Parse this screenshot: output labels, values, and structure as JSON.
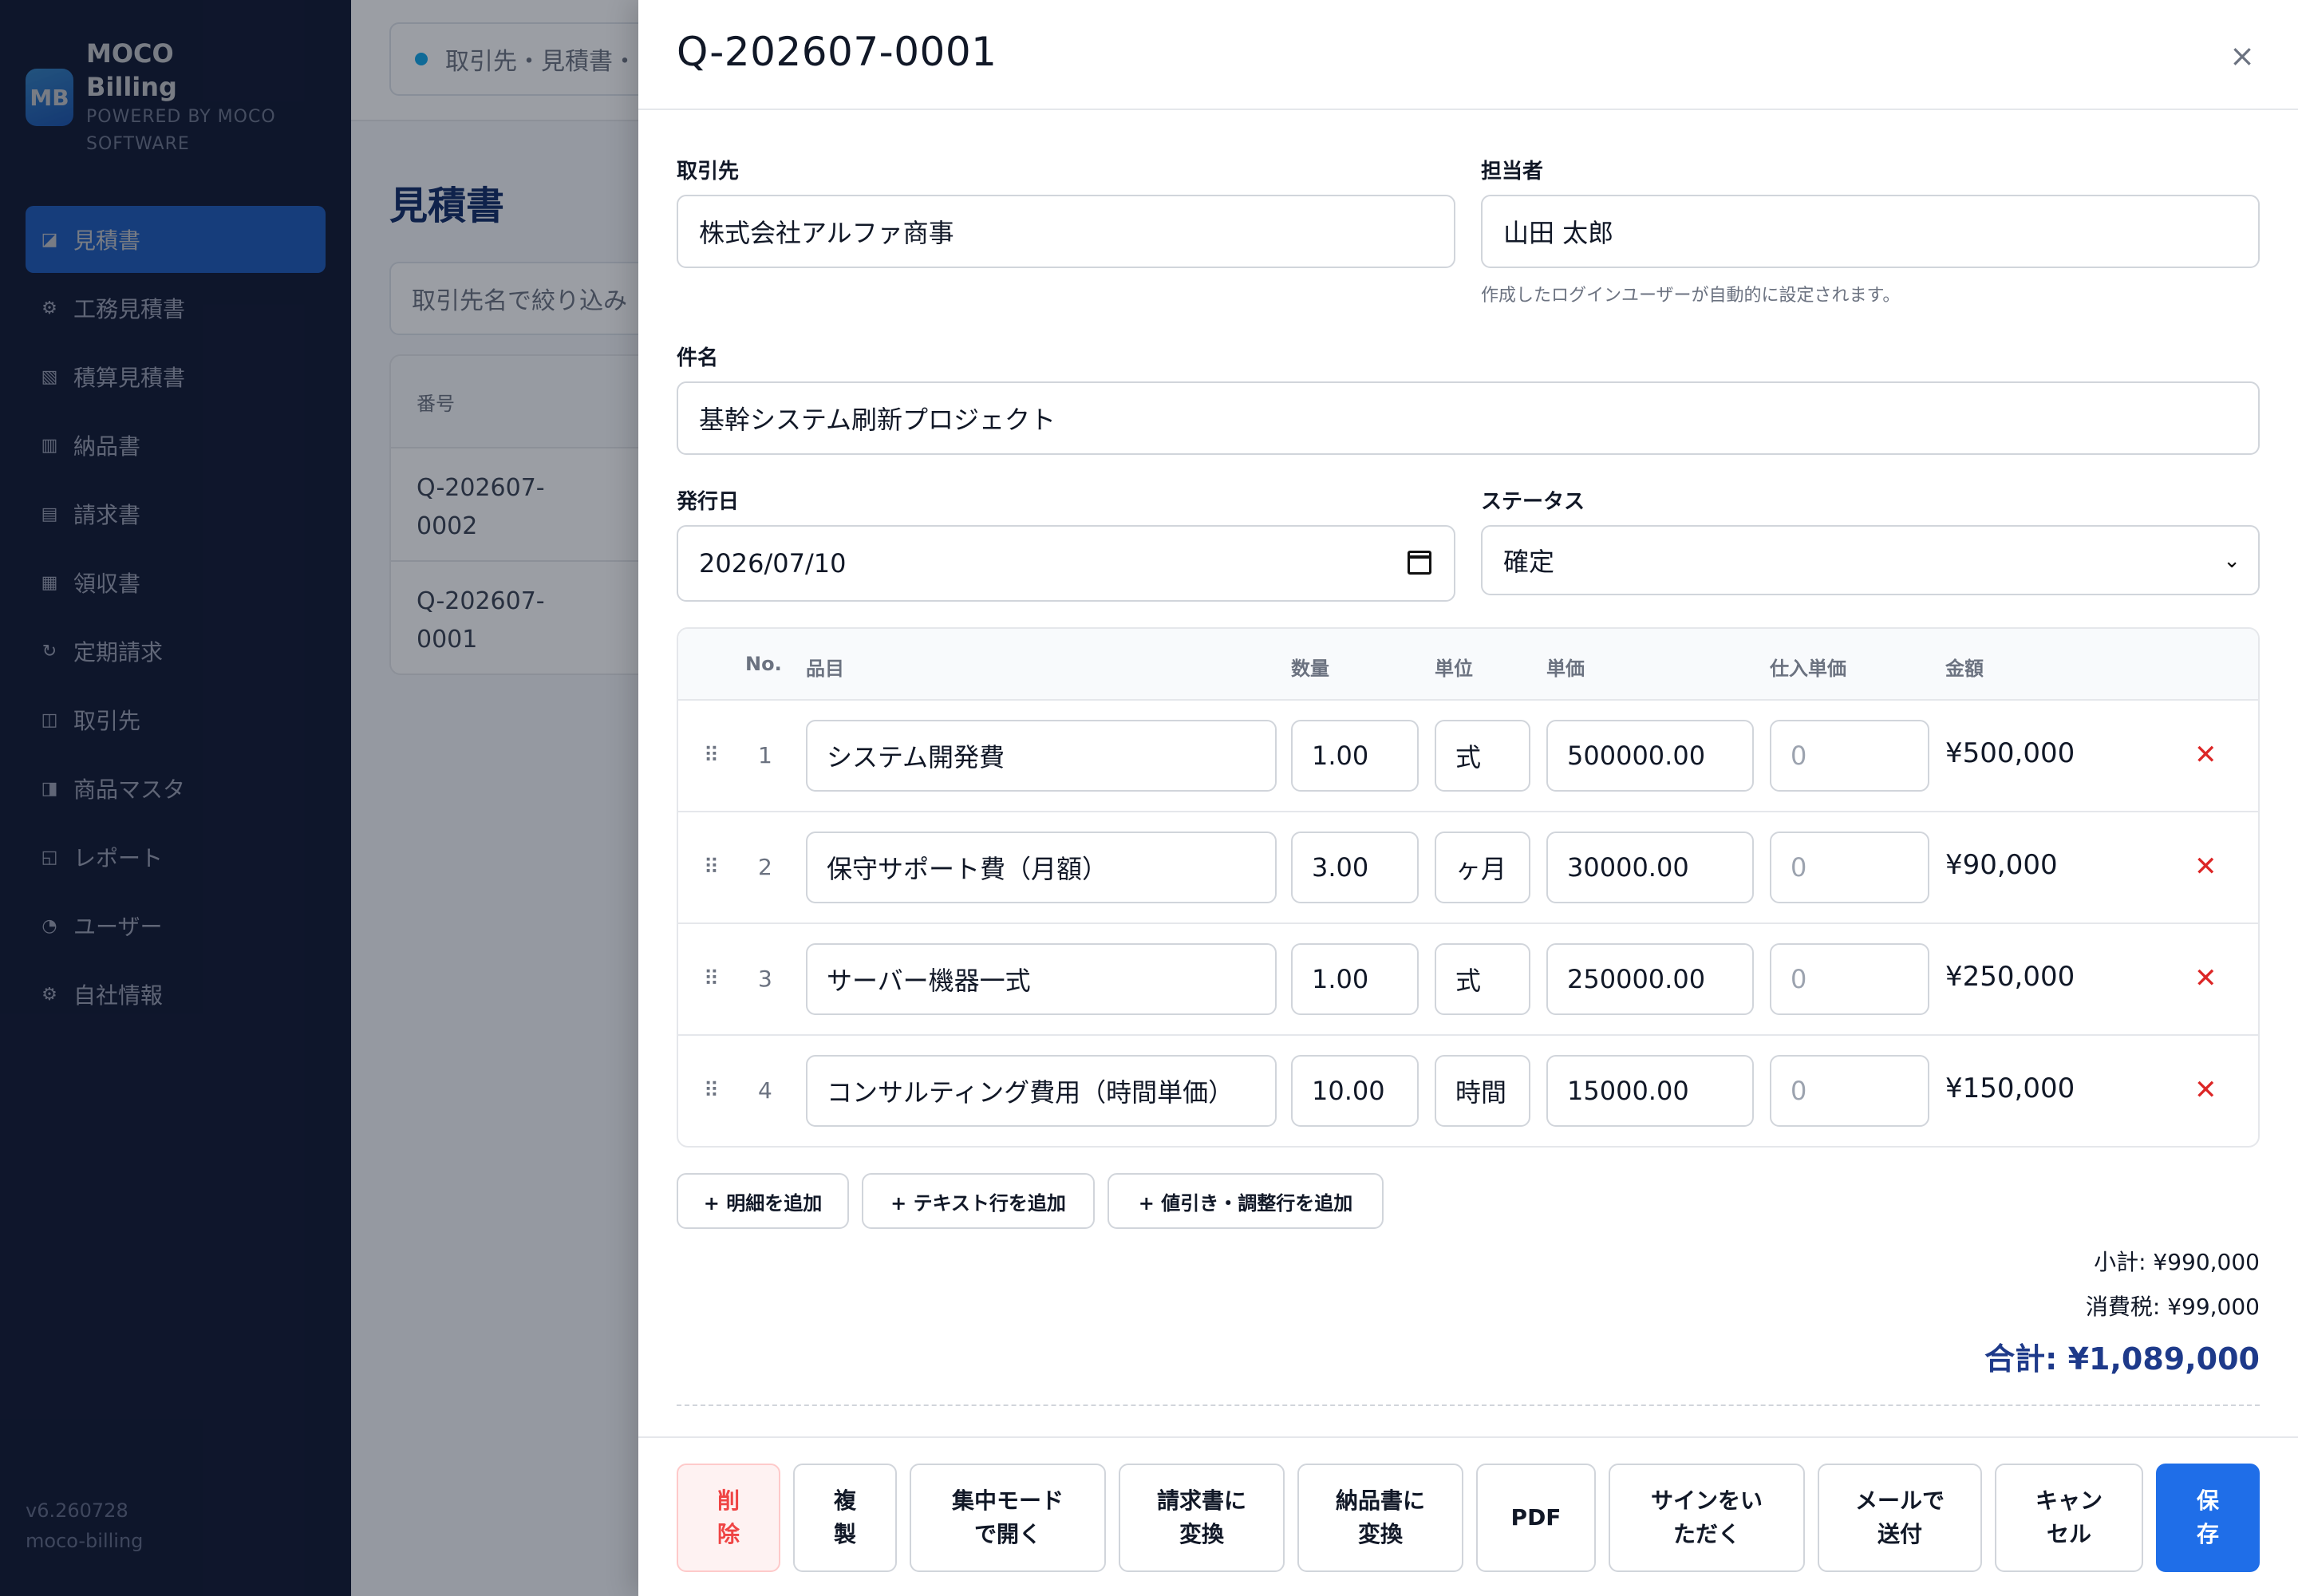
{
  "brand": {
    "logo": "MB",
    "name": "MOCO Billing",
    "sub": "POWERED BY MOCO SOFTWARE"
  },
  "sidebar": {
    "items": [
      {
        "label": "見積書",
        "icon": "document-icon",
        "glyph": "◪"
      },
      {
        "label": "工務見積書",
        "icon": "gear-icon",
        "glyph": "⚙"
      },
      {
        "label": "積算見積書",
        "icon": "hatched-icon",
        "glyph": "▧"
      },
      {
        "label": "納品書",
        "icon": "columns-icon",
        "glyph": "▥"
      },
      {
        "label": "請求書",
        "icon": "list-icon",
        "glyph": "▤"
      },
      {
        "label": "領収書",
        "icon": "grid-icon",
        "glyph": "▦"
      },
      {
        "label": "定期請求",
        "icon": "refresh-icon",
        "glyph": "↻"
      },
      {
        "label": "取引先",
        "icon": "book-icon",
        "glyph": "◫"
      },
      {
        "label": "商品マスタ",
        "icon": "half-square-icon",
        "glyph": "◨"
      },
      {
        "label": "レポート",
        "icon": "report-icon",
        "glyph": "◱"
      },
      {
        "label": "ユーザー",
        "icon": "pie-icon",
        "glyph": "◔"
      },
      {
        "label": "自社情報",
        "icon": "settings-icon",
        "glyph": "⚙"
      }
    ],
    "version": "v6.260728",
    "app_id": "moco-billing"
  },
  "background": {
    "pill": "取引先・見積書・",
    "title": "見積書",
    "search_placeholder": "取引先名で絞り込み",
    "table_header": "番号",
    "rows": [
      "Q-202607-\n0002",
      "Q-202607-\n0001"
    ]
  },
  "drawer": {
    "title": "Q-202607-0001",
    "close": "×",
    "client_label": "取引先",
    "client_value": "株式会社アルファ商事",
    "owner_label": "担当者",
    "owner_value": "山田 太郎",
    "owner_hint": "作成したログインユーザーが自動的に設定されます。",
    "subject_label": "件名",
    "subject_value": "基幹システム刷新プロジェクト",
    "date_label": "発行日",
    "date_value": "2026/07/10",
    "status_label": "ステータス",
    "status_value": "確定"
  },
  "items": {
    "headers": {
      "no": "No.",
      "name": "品目",
      "qty": "数量",
      "unit": "単位",
      "price": "単価",
      "cost": "仕入単価",
      "amount": "金額"
    },
    "rows": [
      {
        "no": "1",
        "name": "システム開発費",
        "qty": "1.00",
        "unit": "式",
        "price": "500000.00",
        "cost": "0",
        "amount": "¥500,000"
      },
      {
        "no": "2",
        "name": "保守サポート費（月額）",
        "qty": "3.00",
        "unit": "ヶ月",
        "price": "30000.00",
        "cost": "0",
        "amount": "¥90,000"
      },
      {
        "no": "3",
        "name": "サーバー機器一式",
        "qty": "1.00",
        "unit": "式",
        "price": "250000.00",
        "cost": "0",
        "amount": "¥250,000"
      },
      {
        "no": "4",
        "name": "コンサルティング費用（時間単価）",
        "qty": "10.00",
        "unit": "時間",
        "price": "15000.00",
        "cost": "0",
        "amount": "¥150,000"
      }
    ],
    "drag_glyph": "⠿",
    "delete_glyph": "✕"
  },
  "add_buttons": [
    "+ 明細を追加",
    "+ テキスト行を追加",
    "+ 値引き・調整行を追加"
  ],
  "totals": {
    "subtotal": "小計: ¥990,000",
    "tax": "消費税: ¥99,000",
    "total": "合計: ¥1,089,000"
  },
  "footer": {
    "delete": "削\n除",
    "duplicate": "複\n製",
    "focus": "集中モード\nで開く",
    "to_invoice": "請求書に\n変換",
    "to_delivery": "納品書に\n変換",
    "pdf": "PDF",
    "sign": "サインをい\nただく",
    "mail": "メールで\n送付",
    "cancel": "キャン\nセル",
    "save": "保\n存"
  },
  "colors": {
    "sidebar": "#0c1433",
    "accent": "#1f6ee8",
    "danger": "#ef4444",
    "total": "#1e3a8a"
  }
}
